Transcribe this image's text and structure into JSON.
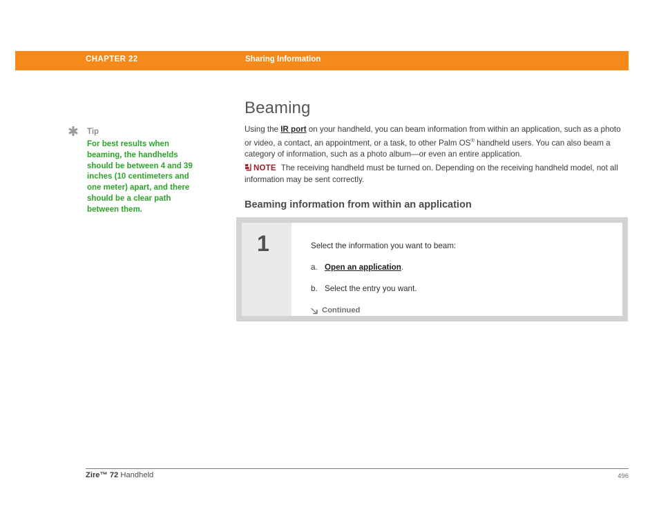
{
  "header": {
    "chapter": "CHAPTER 22",
    "section": "Sharing Information",
    "bar_color": "#f5891a"
  },
  "tip": {
    "icon": "asterisk-icon",
    "label": "Tip",
    "body": "For best results when beaming, the handhelds should be between 4 and 39 inches (10 centimeters and one meter) apart, and there should be a clear path between them.",
    "text_color": "#2da329",
    "label_color": "#8c8c8c"
  },
  "main": {
    "title": "Beaming",
    "intro": {
      "before_link": "Using the ",
      "link": "IR port",
      "after_link": " on your handheld, you can beam information from within an application, such as a photo or video, a contact, an appointment, or a task, to other Palm OS",
      "superscript": "®",
      "tail": " handheld users. You can also beam a category of information, such as a photo album—or even an entire application."
    },
    "note": {
      "icon": "note-arrow-icon",
      "label": "NOTE",
      "label_color": "#a41d2c",
      "text": "The receiving handheld must be turned on. Depending on the receiving handheld model, not all information may be sent correctly."
    },
    "sub_heading": "Beaming information from within an application",
    "step": {
      "number": "1",
      "lead": "Select the information you want to beam:",
      "substeps": [
        {
          "marker": "a.",
          "text": "Open an application",
          "link": true,
          "suffix": "."
        },
        {
          "marker": "b.",
          "text": "Select the entry you want.",
          "link": false,
          "suffix": ""
        }
      ],
      "continued_icon": "arrow-down-right-icon",
      "continued_label": "Continued",
      "frame_color": "#d3d3d3",
      "number_panel_color": "#eaeaea"
    }
  },
  "footer": {
    "brand": "Zire™ 72",
    "product": " Handheld",
    "page_number": "496"
  }
}
